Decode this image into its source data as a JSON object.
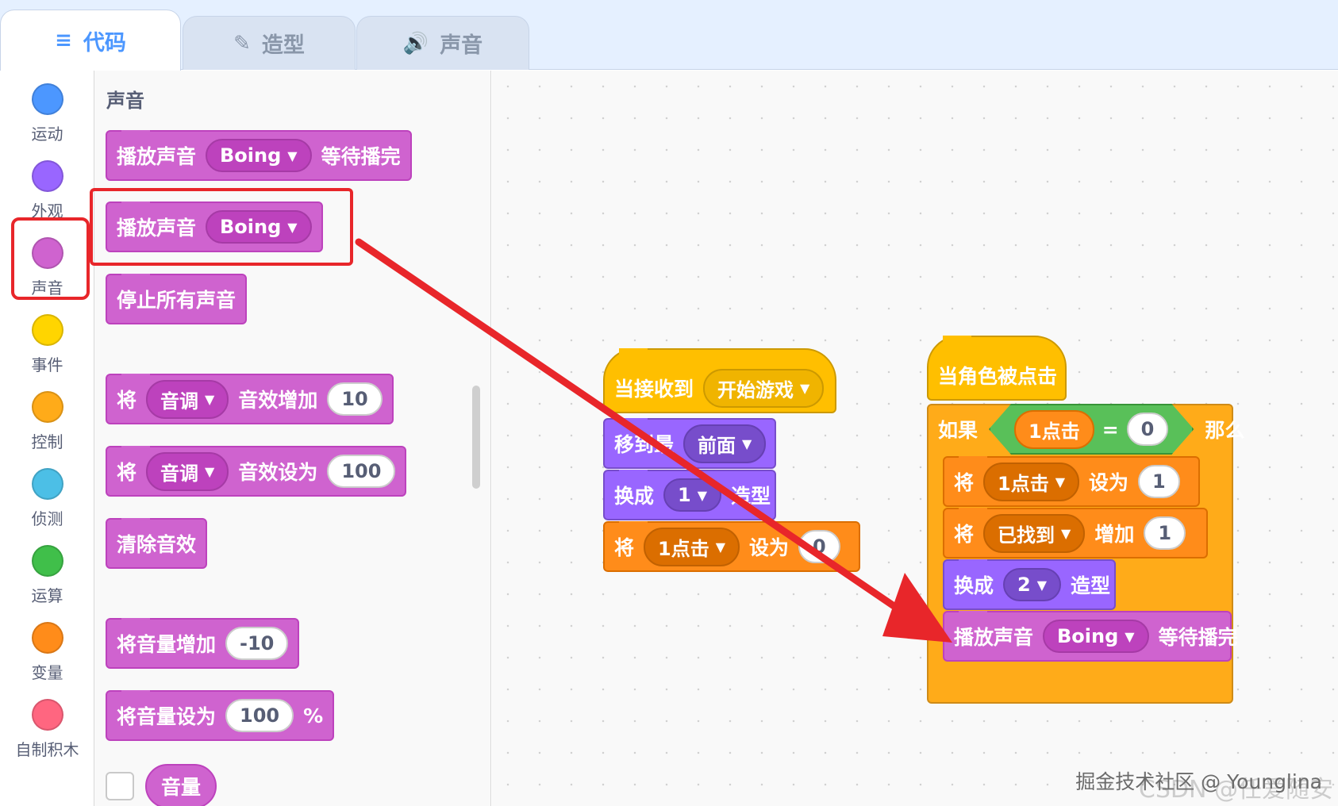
{
  "tabs": [
    {
      "label": "代码",
      "icon": "code-icon"
    },
    {
      "label": "造型",
      "icon": "brush-icon"
    },
    {
      "label": "声音",
      "icon": "speaker-icon"
    }
  ],
  "categories": [
    {
      "label": "运动",
      "color": "#4c97ff"
    },
    {
      "label": "外观",
      "color": "#9966ff"
    },
    {
      "label": "声音",
      "color": "#cf63cf"
    },
    {
      "label": "事件",
      "color": "#ffd500"
    },
    {
      "label": "控制",
      "color": "#ffab19"
    },
    {
      "label": "侦测",
      "color": "#4cbfe6"
    },
    {
      "label": "运算",
      "color": "#40bf4a"
    },
    {
      "label": "变量",
      "color": "#ff8c1a"
    },
    {
      "label": "自制积木",
      "color": "#ff6680"
    }
  ],
  "palette": {
    "title": "声音",
    "play_until_done": {
      "label": "播放声音",
      "sound": "Boing",
      "suffix": "等待播完"
    },
    "play": {
      "label": "播放声音",
      "sound": "Boing"
    },
    "stop_all": {
      "label": "停止所有声音"
    },
    "change_effect": {
      "prefix": "将",
      "effect": "音调",
      "mid": "音效增加",
      "value": "10"
    },
    "set_effect": {
      "prefix": "将",
      "effect": "音调",
      "mid": "音效设为",
      "value": "100"
    },
    "clear_effects": {
      "label": "清除音效"
    },
    "change_volume": {
      "label": "将音量增加",
      "value": "-10"
    },
    "set_volume": {
      "label": "将音量设为",
      "value": "100",
      "suffix": "%"
    },
    "volume_reporter": {
      "label": "音量"
    }
  },
  "script1": {
    "hat": {
      "label": "当接收到",
      "message": "开始游戏"
    },
    "goto": {
      "label": "移到最",
      "option": "前面"
    },
    "switch": {
      "label": "换成",
      "value": "1",
      "suffix": "造型"
    },
    "set_var": {
      "prefix": "将",
      "var": "1点击",
      "mid": "设为",
      "value": "0"
    }
  },
  "script2": {
    "hat": {
      "label": "当角色被点击"
    },
    "if": {
      "label": "如果",
      "left": "1点击",
      "op": "=",
      "right": "0",
      "then": "那么"
    },
    "set_var": {
      "prefix": "将",
      "var": "1点击",
      "mid": "设为",
      "value": "1"
    },
    "change_var": {
      "prefix": "将",
      "var": "已找到",
      "mid": "增加",
      "value": "1"
    },
    "switch": {
      "label": "换成",
      "value": "2",
      "suffix": "造型"
    },
    "play": {
      "label": "播放声音",
      "sound": "Boing",
      "suffix": "等待播完"
    }
  },
  "watermark": "掘金技术社区 @ Younglina",
  "watermark2": "CSDN @任爱随安"
}
